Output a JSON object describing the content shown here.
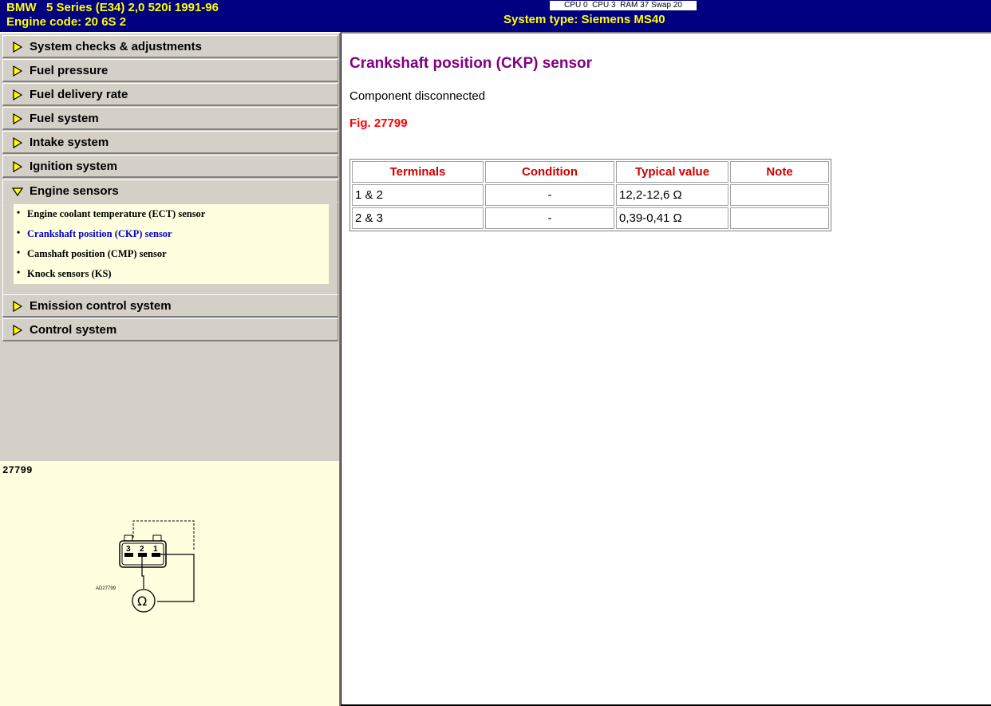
{
  "header": {
    "vehicle_title": "BMW   5 Series (E34) 2,0 520i 1991-96",
    "engine_code": "Engine code: 20 6S 2",
    "system_status": "CPU 0  CPU 3  RAM 37 Swap 20",
    "system_type": "System type: Siemens MS40"
  },
  "nav": {
    "items": [
      {
        "label": "System checks & adjustments"
      },
      {
        "label": "Fuel pressure"
      },
      {
        "label": "Fuel delivery rate"
      },
      {
        "label": "Fuel system"
      },
      {
        "label": "Intake system"
      },
      {
        "label": "Ignition system"
      },
      {
        "label": "Engine sensors"
      },
      {
        "label": "Emission control system"
      },
      {
        "label": "Control system"
      }
    ],
    "sub_items": [
      {
        "label": "Engine coolant temperature (ECT) sensor"
      },
      {
        "label": "Crankshaft position (CKP) sensor"
      },
      {
        "label": "Camshaft position (CMP) sensor"
      },
      {
        "label": "Knock sensors (KS)"
      }
    ],
    "bullet": "•"
  },
  "figure": {
    "number": "27799",
    "terminals": [
      "3",
      "2",
      "1"
    ],
    "code": "AD27799",
    "meter_symbol": "Ω"
  },
  "content": {
    "title": "Crankshaft position (CKP) sensor",
    "status": "Component disconnected",
    "fig_ref": "Fig. 27799",
    "table": {
      "headers": [
        "Terminals",
        "Condition",
        "Typical value",
        "Note"
      ],
      "rows": [
        [
          "1 & 2",
          "-",
          "12,2-12,6 Ω",
          ""
        ],
        [
          "2 & 3",
          "-",
          "0,39-0,41 Ω",
          ""
        ]
      ]
    }
  },
  "colors": {
    "header_bg": "#000080",
    "header_text": "#ffff00",
    "title": "#800080",
    "fig_ref": "#ff0000",
    "active_sub": "#0000cc"
  }
}
